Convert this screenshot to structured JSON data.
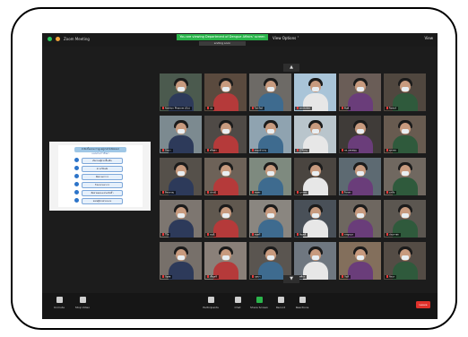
{
  "window": {
    "title": "Zoom Meeting",
    "banner": "You are viewing Department of Dengue Affairs' screen",
    "banner_sub": "ending soon",
    "view_options": "View Options ˅",
    "view_button": "View"
  },
  "share_panel": {
    "heading": "ลำดับขั้นตอนการดูแลผู้ป่วยไข้เลือดออก",
    "subheading": "แนวทางการรักษา",
    "rows": [
      "คัดกรองผู้ป่วยเบื้องต้น",
      "ตรวจวินิจฉัย",
      "ติดตามอาการ",
      "รักษาตามอาการ",
      "ติดตามผลและประเมินซ้ำ",
      "ส่งต่อผู้ป่วยตามระบบ"
    ]
  },
  "participants": [
    "Nakhon Phanom (มีน)",
    "ปอ",
    "ไพรวัลย์",
    "anchalee",
    "พิมพ์",
    "ปิยพงษ์",
    "ปัทมา",
    "ศรีสุดา",
    "คณะทำงาน",
    "ผู้ใช้งาน",
    "รพ.นครพนม",
    "สุภาพร",
    "ทิพวรรณ",
    "ปราณี",
    "สมพร",
    "นภาพร",
    "จิราพร",
    "มาลัย",
    "วิไล",
    "อรุณี",
    "สมศรี",
    "อัญชลี",
    "กาญจนา",
    "ประภาพร",
    "ปัฐพล",
    "เพ็ญศรี",
    "บุษบา",
    "ศศิธร",
    "วันดี",
    "รัตนา"
  ],
  "toolbar": {
    "unmute": "Unmute",
    "stop_video": "Stop Video",
    "participants": "Participants",
    "participants_count": "30",
    "chat": "Chat",
    "share_screen": "Share Screen",
    "record": "Record",
    "reactions": "Reactions",
    "end": "Leave"
  },
  "colors": {
    "banner_green": "#2bb54b",
    "end_red": "#e0312b",
    "background": "#1c1c1c"
  }
}
